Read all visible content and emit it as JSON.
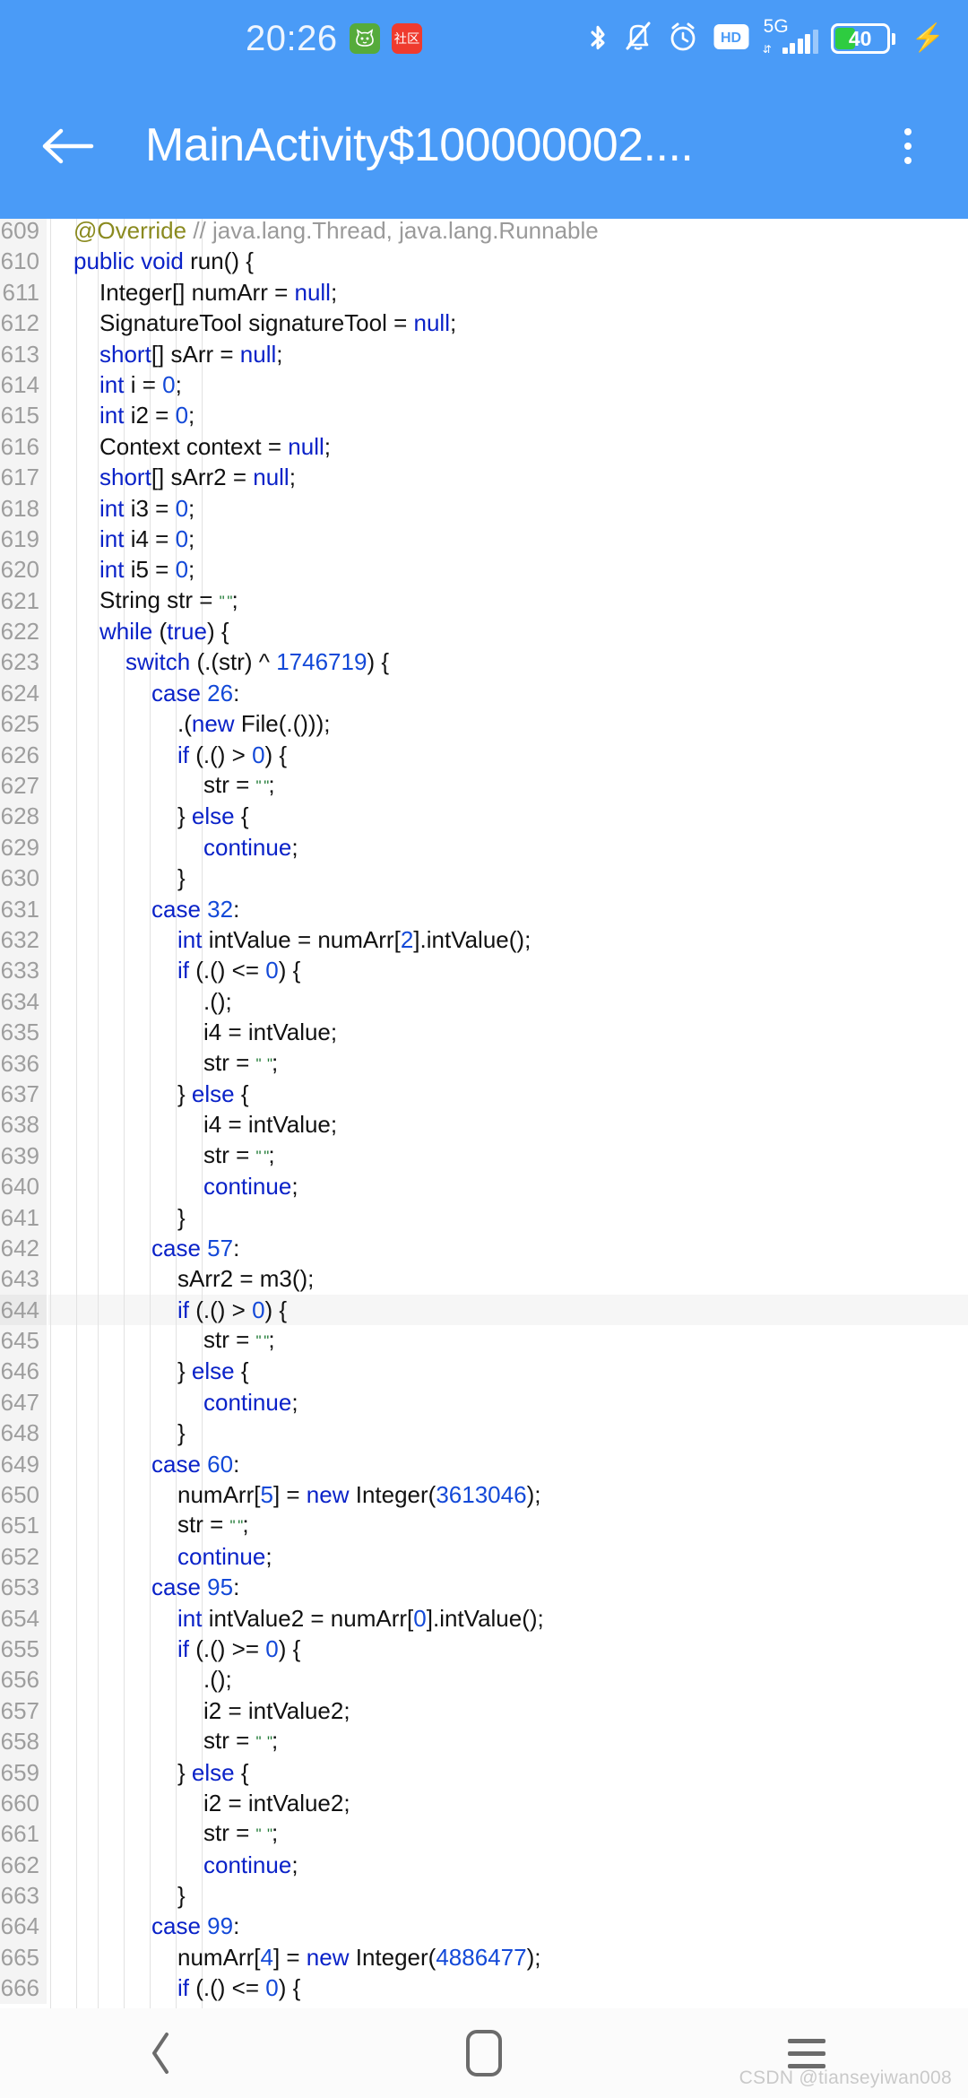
{
  "status_bar": {
    "clock": "20:26",
    "notifications": [
      {
        "name": "cat-app-notification-icon",
        "label": "",
        "color": "#56ab3b"
      },
      {
        "name": "shequ-app-notification-icon",
        "label": "社区",
        "color": "#ef3b2e"
      }
    ],
    "icons": [
      "bluetooth-icon",
      "bell-muted-icon",
      "alarm-clock-icon",
      "hd-icon",
      "signal-5g-icon",
      "battery-icon"
    ],
    "hd_label": "HD",
    "network_label": "5G",
    "data_arrows": "⇵",
    "battery_percent": "40",
    "battery_level": 40,
    "charging_glyph": "⚡",
    "bar_color": "#4a9bf7",
    "battery_fill_color": "#2ecc40"
  },
  "app_bar": {
    "back_label": "←",
    "title": "MainActivity$100000002....",
    "overflow_label": "⋮"
  },
  "editor": {
    "first_line": 609,
    "gutter_color": "#f4f4f4",
    "line_number_color": "#9e9e9e",
    "highlight_line": 644,
    "lines": [
      {
        "n": 609,
        "indent": 1,
        "tokens": [
          {
            "t": "@Override",
            "c": "ann"
          },
          {
            "t": " ",
            "c": "plain"
          },
          {
            "t": "// java.lang.Thread, java.lang.Runnable",
            "c": "cmt"
          }
        ]
      },
      {
        "n": 610,
        "indent": 1,
        "tokens": [
          {
            "t": "public void ",
            "c": "kw"
          },
          {
            "t": "run() {",
            "c": "plain"
          }
        ]
      },
      {
        "n": 611,
        "indent": 2,
        "tokens": [
          {
            "t": "Integer[] numArr = ",
            "c": "plain"
          },
          {
            "t": "null",
            "c": "kw"
          },
          {
            "t": ";",
            "c": "plain"
          }
        ]
      },
      {
        "n": 612,
        "indent": 2,
        "tokens": [
          {
            "t": "SignatureTool signatureTool = ",
            "c": "plain"
          },
          {
            "t": "null",
            "c": "kw"
          },
          {
            "t": ";",
            "c": "plain"
          }
        ]
      },
      {
        "n": 613,
        "indent": 2,
        "tokens": [
          {
            "t": "short",
            "c": "kw"
          },
          {
            "t": "[] sArr = ",
            "c": "plain"
          },
          {
            "t": "null",
            "c": "kw"
          },
          {
            "t": ";",
            "c": "plain"
          }
        ]
      },
      {
        "n": 614,
        "indent": 2,
        "tokens": [
          {
            "t": "int ",
            "c": "kw"
          },
          {
            "t": "i = ",
            "c": "plain"
          },
          {
            "t": "0",
            "c": "num"
          },
          {
            "t": ";",
            "c": "plain"
          }
        ]
      },
      {
        "n": 615,
        "indent": 2,
        "tokens": [
          {
            "t": "int ",
            "c": "kw"
          },
          {
            "t": "i2 = ",
            "c": "plain"
          },
          {
            "t": "0",
            "c": "num"
          },
          {
            "t": ";",
            "c": "plain"
          }
        ]
      },
      {
        "n": 616,
        "indent": 2,
        "tokens": [
          {
            "t": "Context context = ",
            "c": "plain"
          },
          {
            "t": "null",
            "c": "kw"
          },
          {
            "t": ";",
            "c": "plain"
          }
        ]
      },
      {
        "n": 617,
        "indent": 2,
        "tokens": [
          {
            "t": "short",
            "c": "kw"
          },
          {
            "t": "[] sArr2 = ",
            "c": "plain"
          },
          {
            "t": "null",
            "c": "kw"
          },
          {
            "t": ";",
            "c": "plain"
          }
        ]
      },
      {
        "n": 618,
        "indent": 2,
        "tokens": [
          {
            "t": "int ",
            "c": "kw"
          },
          {
            "t": "i3 = ",
            "c": "plain"
          },
          {
            "t": "0",
            "c": "num"
          },
          {
            "t": ";",
            "c": "plain"
          }
        ]
      },
      {
        "n": 619,
        "indent": 2,
        "tokens": [
          {
            "t": "int ",
            "c": "kw"
          },
          {
            "t": "i4 = ",
            "c": "plain"
          },
          {
            "t": "0",
            "c": "num"
          },
          {
            "t": ";",
            "c": "plain"
          }
        ]
      },
      {
        "n": 620,
        "indent": 2,
        "tokens": [
          {
            "t": "int ",
            "c": "kw"
          },
          {
            "t": "i5 = ",
            "c": "plain"
          },
          {
            "t": "0",
            "c": "num"
          },
          {
            "t": ";",
            "c": "plain"
          }
        ]
      },
      {
        "n": 621,
        "indent": 2,
        "tokens": [
          {
            "t": "String str = ",
            "c": "plain"
          },
          {
            "t": "\" \"",
            "c": "str"
          },
          {
            "t": ";",
            "c": "plain"
          }
        ]
      },
      {
        "n": 622,
        "indent": 2,
        "tokens": [
          {
            "t": "while ",
            "c": "kw"
          },
          {
            "t": "(",
            "c": "plain"
          },
          {
            "t": "true",
            "c": "kw"
          },
          {
            "t": ") {",
            "c": "plain"
          }
        ]
      },
      {
        "n": 623,
        "indent": 3,
        "tokens": [
          {
            "t": "switch ",
            "c": "kw"
          },
          {
            "t": "(.(str) ^ ",
            "c": "plain"
          },
          {
            "t": "1746719",
            "c": "num"
          },
          {
            "t": ") {",
            "c": "plain"
          }
        ]
      },
      {
        "n": 624,
        "indent": 4,
        "tokens": [
          {
            "t": "case ",
            "c": "kw"
          },
          {
            "t": "26",
            "c": "num"
          },
          {
            "t": ":",
            "c": "plain"
          }
        ]
      },
      {
        "n": 625,
        "indent": 5,
        "tokens": [
          {
            "t": ".(",
            "c": "plain"
          },
          {
            "t": "new ",
            "c": "kw"
          },
          {
            "t": "File(.()));",
            "c": "plain"
          }
        ]
      },
      {
        "n": 626,
        "indent": 5,
        "tokens": [
          {
            "t": "if ",
            "c": "kw"
          },
          {
            "t": "(.() > ",
            "c": "plain"
          },
          {
            "t": "0",
            "c": "num"
          },
          {
            "t": ") {",
            "c": "plain"
          }
        ]
      },
      {
        "n": 627,
        "indent": 6,
        "tokens": [
          {
            "t": "str = ",
            "c": "plain"
          },
          {
            "t": "\" \"",
            "c": "str"
          },
          {
            "t": ";",
            "c": "plain"
          }
        ]
      },
      {
        "n": 628,
        "indent": 5,
        "tokens": [
          {
            "t": "} ",
            "c": "plain"
          },
          {
            "t": "else ",
            "c": "kw"
          },
          {
            "t": "{",
            "c": "plain"
          }
        ]
      },
      {
        "n": 629,
        "indent": 6,
        "tokens": [
          {
            "t": "continue",
            "c": "kw"
          },
          {
            "t": ";",
            "c": "plain"
          }
        ]
      },
      {
        "n": 630,
        "indent": 5,
        "tokens": [
          {
            "t": "}",
            "c": "plain"
          }
        ]
      },
      {
        "n": 631,
        "indent": 4,
        "tokens": [
          {
            "t": "case ",
            "c": "kw"
          },
          {
            "t": "32",
            "c": "num"
          },
          {
            "t": ":",
            "c": "plain"
          }
        ]
      },
      {
        "n": 632,
        "indent": 5,
        "tokens": [
          {
            "t": "int ",
            "c": "kw"
          },
          {
            "t": "intValue = numArr[",
            "c": "plain"
          },
          {
            "t": "2",
            "c": "num"
          },
          {
            "t": "].intValue();",
            "c": "plain"
          }
        ]
      },
      {
        "n": 633,
        "indent": 5,
        "tokens": [
          {
            "t": "if ",
            "c": "kw"
          },
          {
            "t": "(.() <= ",
            "c": "plain"
          },
          {
            "t": "0",
            "c": "num"
          },
          {
            "t": ") {",
            "c": "plain"
          }
        ]
      },
      {
        "n": 634,
        "indent": 6,
        "tokens": [
          {
            "t": ".();",
            "c": "plain"
          }
        ]
      },
      {
        "n": 635,
        "indent": 6,
        "tokens": [
          {
            "t": "i4 = intValue;",
            "c": "plain"
          }
        ]
      },
      {
        "n": 636,
        "indent": 6,
        "tokens": [
          {
            "t": "str = ",
            "c": "plain"
          },
          {
            "t": "\"  \"",
            "c": "str"
          },
          {
            "t": ";",
            "c": "plain"
          }
        ]
      },
      {
        "n": 637,
        "indent": 5,
        "tokens": [
          {
            "t": "} ",
            "c": "plain"
          },
          {
            "t": "else ",
            "c": "kw"
          },
          {
            "t": "{",
            "c": "plain"
          }
        ]
      },
      {
        "n": 638,
        "indent": 6,
        "tokens": [
          {
            "t": "i4 = intValue;",
            "c": "plain"
          }
        ]
      },
      {
        "n": 639,
        "indent": 6,
        "tokens": [
          {
            "t": "str = ",
            "c": "plain"
          },
          {
            "t": "\" \"",
            "c": "str"
          },
          {
            "t": ";",
            "c": "plain"
          }
        ]
      },
      {
        "n": 640,
        "indent": 6,
        "tokens": [
          {
            "t": "continue",
            "c": "kw"
          },
          {
            "t": ";",
            "c": "plain"
          }
        ]
      },
      {
        "n": 641,
        "indent": 5,
        "tokens": [
          {
            "t": "}",
            "c": "plain"
          }
        ]
      },
      {
        "n": 642,
        "indent": 4,
        "tokens": [
          {
            "t": "case ",
            "c": "kw"
          },
          {
            "t": "57",
            "c": "num"
          },
          {
            "t": ":",
            "c": "plain"
          }
        ]
      },
      {
        "n": 643,
        "indent": 5,
        "tokens": [
          {
            "t": "sArr2 = m3();",
            "c": "plain"
          }
        ]
      },
      {
        "n": 644,
        "indent": 5,
        "tokens": [
          {
            "t": "if ",
            "c": "kw"
          },
          {
            "t": "(.() > ",
            "c": "plain"
          },
          {
            "t": "0",
            "c": "num"
          },
          {
            "t": ") {",
            "c": "plain"
          }
        ]
      },
      {
        "n": 645,
        "indent": 6,
        "tokens": [
          {
            "t": "str = ",
            "c": "plain"
          },
          {
            "t": "\" \"",
            "c": "str"
          },
          {
            "t": ";",
            "c": "plain"
          }
        ]
      },
      {
        "n": 646,
        "indent": 5,
        "tokens": [
          {
            "t": "} ",
            "c": "plain"
          },
          {
            "t": "else ",
            "c": "kw"
          },
          {
            "t": "{",
            "c": "plain"
          }
        ]
      },
      {
        "n": 647,
        "indent": 6,
        "tokens": [
          {
            "t": "continue",
            "c": "kw"
          },
          {
            "t": ";",
            "c": "plain"
          }
        ]
      },
      {
        "n": 648,
        "indent": 5,
        "tokens": [
          {
            "t": "}",
            "c": "plain"
          }
        ]
      },
      {
        "n": 649,
        "indent": 4,
        "tokens": [
          {
            "t": "case ",
            "c": "kw"
          },
          {
            "t": "60",
            "c": "num"
          },
          {
            "t": ":",
            "c": "plain"
          }
        ]
      },
      {
        "n": 650,
        "indent": 5,
        "tokens": [
          {
            "t": "numArr[",
            "c": "plain"
          },
          {
            "t": "5",
            "c": "num"
          },
          {
            "t": "] = ",
            "c": "plain"
          },
          {
            "t": "new ",
            "c": "kw"
          },
          {
            "t": "Integer(",
            "c": "plain"
          },
          {
            "t": "3613046",
            "c": "num"
          },
          {
            "t": ");",
            "c": "plain"
          }
        ]
      },
      {
        "n": 651,
        "indent": 5,
        "tokens": [
          {
            "t": "str = ",
            "c": "plain"
          },
          {
            "t": "\" \"",
            "c": "str"
          },
          {
            "t": ";",
            "c": "plain"
          }
        ]
      },
      {
        "n": 652,
        "indent": 5,
        "tokens": [
          {
            "t": "continue",
            "c": "kw"
          },
          {
            "t": ";",
            "c": "plain"
          }
        ]
      },
      {
        "n": 653,
        "indent": 4,
        "tokens": [
          {
            "t": "case ",
            "c": "kw"
          },
          {
            "t": "95",
            "c": "num"
          },
          {
            "t": ":",
            "c": "plain"
          }
        ]
      },
      {
        "n": 654,
        "indent": 5,
        "tokens": [
          {
            "t": "int ",
            "c": "kw"
          },
          {
            "t": "intValue2 = numArr[",
            "c": "plain"
          },
          {
            "t": "0",
            "c": "num"
          },
          {
            "t": "].intValue();",
            "c": "plain"
          }
        ]
      },
      {
        "n": 655,
        "indent": 5,
        "tokens": [
          {
            "t": "if ",
            "c": "kw"
          },
          {
            "t": "(.() >= ",
            "c": "plain"
          },
          {
            "t": "0",
            "c": "num"
          },
          {
            "t": ") {",
            "c": "plain"
          }
        ]
      },
      {
        "n": 656,
        "indent": 6,
        "tokens": [
          {
            "t": ".();",
            "c": "plain"
          }
        ]
      },
      {
        "n": 657,
        "indent": 6,
        "tokens": [
          {
            "t": "i2 = intValue2;",
            "c": "plain"
          }
        ]
      },
      {
        "n": 658,
        "indent": 6,
        "tokens": [
          {
            "t": "str = ",
            "c": "plain"
          },
          {
            "t": "\"  \"",
            "c": "str"
          },
          {
            "t": ";",
            "c": "plain"
          }
        ]
      },
      {
        "n": 659,
        "indent": 5,
        "tokens": [
          {
            "t": "} ",
            "c": "plain"
          },
          {
            "t": "else ",
            "c": "kw"
          },
          {
            "t": "{",
            "c": "plain"
          }
        ]
      },
      {
        "n": 660,
        "indent": 6,
        "tokens": [
          {
            "t": "i2 = intValue2;",
            "c": "plain"
          }
        ]
      },
      {
        "n": 661,
        "indent": 6,
        "tokens": [
          {
            "t": "str = ",
            "c": "plain"
          },
          {
            "t": "\"  \"",
            "c": "str"
          },
          {
            "t": ";",
            "c": "plain"
          }
        ]
      },
      {
        "n": 662,
        "indent": 6,
        "tokens": [
          {
            "t": "continue",
            "c": "kw"
          },
          {
            "t": ";",
            "c": "plain"
          }
        ]
      },
      {
        "n": 663,
        "indent": 5,
        "tokens": [
          {
            "t": "}",
            "c": "plain"
          }
        ]
      },
      {
        "n": 664,
        "indent": 4,
        "tokens": [
          {
            "t": "case ",
            "c": "kw"
          },
          {
            "t": "99",
            "c": "num"
          },
          {
            "t": ":",
            "c": "plain"
          }
        ]
      },
      {
        "n": 665,
        "indent": 5,
        "tokens": [
          {
            "t": "numArr[",
            "c": "plain"
          },
          {
            "t": "4",
            "c": "num"
          },
          {
            "t": "] = ",
            "c": "plain"
          },
          {
            "t": "new ",
            "c": "kw"
          },
          {
            "t": "Integer(",
            "c": "plain"
          },
          {
            "t": "4886477",
            "c": "num"
          },
          {
            "t": ");",
            "c": "plain"
          }
        ]
      },
      {
        "n": 666,
        "indent": 5,
        "tokens": [
          {
            "t": "if ",
            "c": "kw"
          },
          {
            "t": "(.() <= ",
            "c": "plain"
          },
          {
            "t": "0",
            "c": "num"
          },
          {
            "t": ") {",
            "c": "plain"
          }
        ]
      }
    ]
  },
  "nav_bar": {
    "back_label": "‹",
    "home_label": "home",
    "recents_label": "recents"
  },
  "watermark": "CSDN @tianseyiwan008"
}
